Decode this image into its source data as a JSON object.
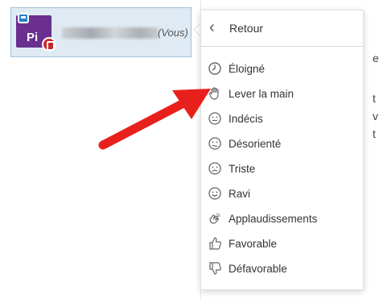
{
  "participant": {
    "initials": "Pi",
    "you_label": "(Vous)"
  },
  "status_menu": {
    "back_label": "Retour",
    "items": [
      {
        "label": "Éloigné",
        "icon": "clock-icon"
      },
      {
        "label": "Lever la main",
        "icon": "raised-hand-icon"
      },
      {
        "label": "Indécis",
        "icon": "neutral-face-icon"
      },
      {
        "label": "Désorienté",
        "icon": "confused-face-icon"
      },
      {
        "label": "Triste",
        "icon": "sad-face-icon"
      },
      {
        "label": "Ravi",
        "icon": "happy-face-icon"
      },
      {
        "label": "Applaudissements",
        "icon": "clapping-hands-icon"
      },
      {
        "label": "Favorable",
        "icon": "thumbs-up-icon"
      },
      {
        "label": "Défavorable",
        "icon": "thumbs-down-icon"
      }
    ]
  },
  "colors": {
    "avatar": "#6a2f8f",
    "status_badge": "#c52b2b",
    "selected_row": "#dfeaf3",
    "annotation_arrow": "#e8201c"
  }
}
